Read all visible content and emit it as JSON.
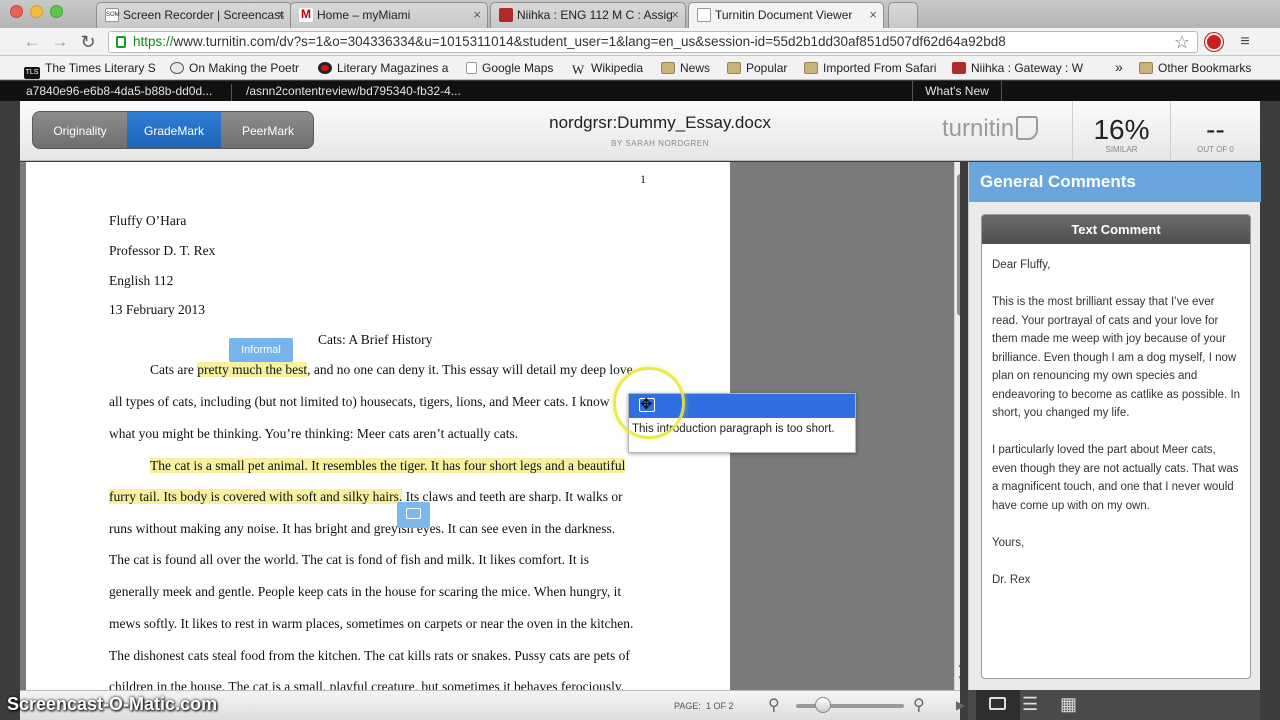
{
  "browser": {
    "tabs": [
      {
        "title": "Screen Recorder | Screencast",
        "favicon_label": "SOM",
        "active": false
      },
      {
        "title": "Home – myMiami",
        "favicon_label": "M",
        "active": false
      },
      {
        "title": "Niihka : ENG 112 M C : Assig",
        "favicon_label": "",
        "active": false
      },
      {
        "title": "Turnitin Document Viewer",
        "favicon_label": "",
        "active": true
      }
    ],
    "url_scheme": "https://",
    "url_rest": "www.turnitin.com/dv?s=1&o=304336334&u=1015311014&student_user=1&lang=en_us&session-id=55d2b1dd30af851d507df62d64a92bd8",
    "bookmarks": [
      {
        "label": "The Times Literary S",
        "icon": "TLS"
      },
      {
        "label": "On Making the Poetr",
        "icon": "wordpress-icon"
      },
      {
        "label": "Literary Magazines a",
        "icon": "record-icon"
      },
      {
        "label": "Google Maps",
        "icon": "file-icon"
      },
      {
        "label": "Wikipedia",
        "icon": "W"
      },
      {
        "label": "News",
        "icon": "folder-icon"
      },
      {
        "label": "Popular",
        "icon": "folder-icon"
      },
      {
        "label": "Imported From Safari",
        "icon": "folder-icon"
      },
      {
        "label": "Niihka : Gateway : W",
        "icon": "niihka-icon"
      }
    ],
    "bookmarks_overflow": "»",
    "other_bookmarks": "Other Bookmarks",
    "infobar": {
      "left": "a7840e96-e6b8-4da5-b88b-dd0d...",
      "middle": "/asnn2contentreview/bd795340-fb32-4...",
      "whats_new": "What's New"
    }
  },
  "turnitin": {
    "modes": [
      "Originality",
      "GradeMark",
      "PeerMark"
    ],
    "active_mode": "GradeMark",
    "doc_title": "nordgrsr:Dummy_Essay.docx",
    "doc_author": "BY SARAH NORDGREN",
    "logo": "turnitin",
    "similarity": {
      "value": "16%",
      "label": "SIMILAR"
    },
    "grade": {
      "value": "--",
      "label": "OUT OF 0"
    }
  },
  "document": {
    "page_number": "1",
    "header_lines": [
      "Fluffy O’Hara",
      "Professor D. T. Rex",
      "English 112",
      "13 February 2013"
    ],
    "title": "Cats: A Brief History",
    "p1": {
      "l1_a": "Cats are ",
      "l1_hl": "pretty much the best",
      "l1_b": ", and no one can deny it. This essay will detail my deep love",
      "l2": "all types of cats, including (but not limited to) housecats, tigers, lions, and Meer cats. I know",
      "l3": "what you might be thinking. You’re thinking: Meer cats aren’t actually cats."
    },
    "p2": {
      "l1_hl": "The cat is a small pet animal. It resembles the tiger. It has four short legs and a beautiful",
      "l2_hl": "furry tail. Its body is covered with soft and silky hairs.",
      "l2_b": " Its claws and teeth are sharp. It walks or",
      "l3": "runs without making any noise. It has bright and greyish eyes. It can see even in the darkness.",
      "l4": "The cat is found all over the world. The cat is fond of fish and milk. It likes comfort. It is",
      "l5": "generally meek and gentle. People keep cats in the house for scaring the mice. When hungry, it",
      "l6": "mews softly. It likes to rest in warm places, sometimes on carpets or near the oven in the kitchen.",
      "l7": "The dishonest cats steal food from the kitchen. The cat kills rats or snakes. Pussy cats are pets of",
      "l8": "children in the house. The cat is a small, playful creature, but sometimes it behaves ferociously."
    },
    "annotation_informal": "Informal",
    "popup_comment": "This introduction paragraph is too short."
  },
  "bottom_bar": {
    "page_label": "PAGE:",
    "page_value": "1 OF 2"
  },
  "general_comments": {
    "heading": "General Comments",
    "box_title": "Text Comment",
    "paragraphs": [
      "Dear Fluffy,",
      "This is the most brilliant essay that I’ve ever read. Your portrayal of cats and your love for them made me weep with joy because of your brilliance. Even though I am a dog myself, I now plan on renouncing my own species and endeavoring to become as catlike as possible. In short, you changed my life.",
      "I particularly loved the part about Meer cats, even though they are not actually cats. That was a magnificent touch, and one that I never would have come up with on my own.",
      "Yours,",
      "Dr. Rex"
    ]
  },
  "watermark": "Screencast-O-Matic.com",
  "colors": {
    "accent_blue": "#6aa6de",
    "highlight_yellow": "#f7f0a0",
    "popup_blue": "#2f6fe0"
  }
}
